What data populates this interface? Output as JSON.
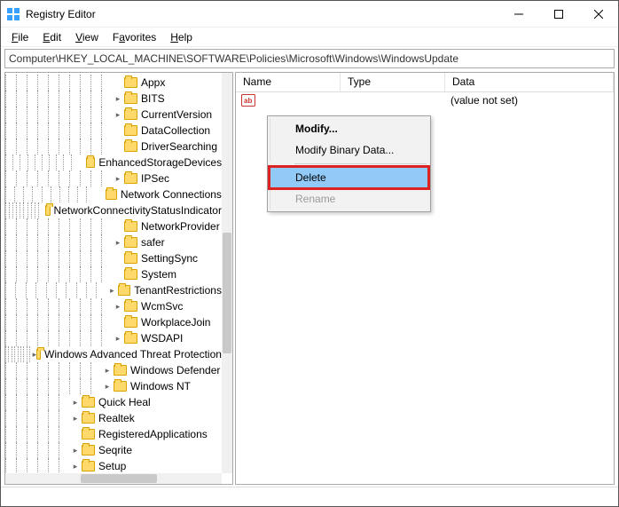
{
  "window": {
    "title": "Registry Editor"
  },
  "menubar": {
    "file": "File",
    "edit": "Edit",
    "view": "View",
    "favorites": "Favorites",
    "help": "Help"
  },
  "address": "Computer\\HKEY_LOCAL_MACHINE\\SOFTWARE\\Policies\\Microsoft\\Windows\\WindowsUpdate",
  "tree": {
    "items": [
      {
        "label": "Appx",
        "depth": 10,
        "twisty": ""
      },
      {
        "label": "BITS",
        "depth": 10,
        "twisty": "collapsed"
      },
      {
        "label": "CurrentVersion",
        "depth": 10,
        "twisty": "collapsed"
      },
      {
        "label": "DataCollection",
        "depth": 10,
        "twisty": ""
      },
      {
        "label": "DriverSearching",
        "depth": 10,
        "twisty": ""
      },
      {
        "label": "EnhancedStorageDevices",
        "depth": 10,
        "twisty": ""
      },
      {
        "label": "IPSec",
        "depth": 10,
        "twisty": "collapsed"
      },
      {
        "label": "Network Connections",
        "depth": 10,
        "twisty": ""
      },
      {
        "label": "NetworkConnectivityStatusIndicator",
        "depth": 10,
        "twisty": ""
      },
      {
        "label": "NetworkProvider",
        "depth": 10,
        "twisty": ""
      },
      {
        "label": "safer",
        "depth": 10,
        "twisty": "collapsed"
      },
      {
        "label": "SettingSync",
        "depth": 10,
        "twisty": ""
      },
      {
        "label": "System",
        "depth": 10,
        "twisty": ""
      },
      {
        "label": "TenantRestrictions",
        "depth": 10,
        "twisty": "collapsed"
      },
      {
        "label": "WcmSvc",
        "depth": 10,
        "twisty": "collapsed"
      },
      {
        "label": "WorkplaceJoin",
        "depth": 10,
        "twisty": ""
      },
      {
        "label": "WSDAPI",
        "depth": 10,
        "twisty": "collapsed"
      },
      {
        "label": "Windows Advanced Threat Protection",
        "depth": 9,
        "twisty": "collapsed"
      },
      {
        "label": "Windows Defender",
        "depth": 9,
        "twisty": "collapsed"
      },
      {
        "label": "Windows NT",
        "depth": 9,
        "twisty": "collapsed"
      },
      {
        "label": "Quick Heal",
        "depth": 6,
        "twisty": "collapsed"
      },
      {
        "label": "Realtek",
        "depth": 6,
        "twisty": "collapsed"
      },
      {
        "label": "RegisteredApplications",
        "depth": 6,
        "twisty": ""
      },
      {
        "label": "Seqrite",
        "depth": 6,
        "twisty": "collapsed"
      },
      {
        "label": "Setup",
        "depth": 6,
        "twisty": "collapsed"
      }
    ]
  },
  "list": {
    "columns": {
      "name": "Name",
      "type": "Type",
      "data": "Data"
    },
    "row": {
      "name": "",
      "type": "",
      "data": "(value not set)"
    }
  },
  "context_menu": {
    "modify": "Modify...",
    "modify_binary": "Modify Binary Data...",
    "delete": "Delete",
    "rename": "Rename"
  }
}
